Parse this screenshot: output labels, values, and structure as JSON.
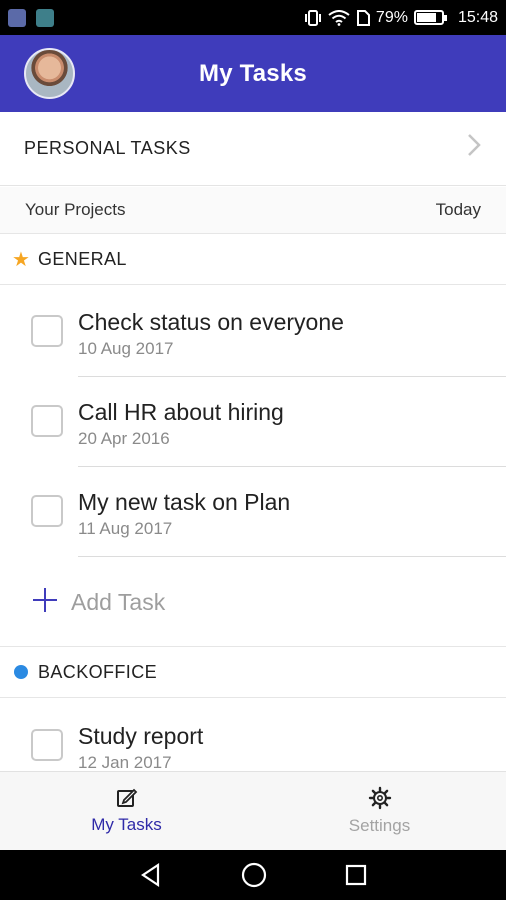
{
  "status_bar": {
    "battery_percent": "79%",
    "battery_level": 0.79,
    "time": "15:48"
  },
  "app_bar": {
    "title": "My Tasks"
  },
  "personal": {
    "label": "PERSONAL TASKS"
  },
  "projects_header": {
    "left": "Your Projects",
    "right": "Today"
  },
  "groups": [
    {
      "name": "GENERAL",
      "tasks": [
        {
          "title": "Check status on everyone",
          "date": "10 Aug 2017"
        },
        {
          "title": "Call HR about hiring",
          "date": "20 Apr 2016"
        },
        {
          "title": "My new task on Plan",
          "date": "11 Aug 2017"
        }
      ],
      "add_label": "Add Task"
    },
    {
      "name": "BACKOFFICE",
      "tasks": [
        {
          "title": "Study report",
          "date": "12 Jan 2017"
        }
      ]
    }
  ],
  "bottom_nav": {
    "my_tasks": "My Tasks",
    "settings": "Settings"
  },
  "colors": {
    "accent": "#3f3cbb",
    "star": "#f6a623",
    "backoffice_dot": "#2b8ae2"
  }
}
